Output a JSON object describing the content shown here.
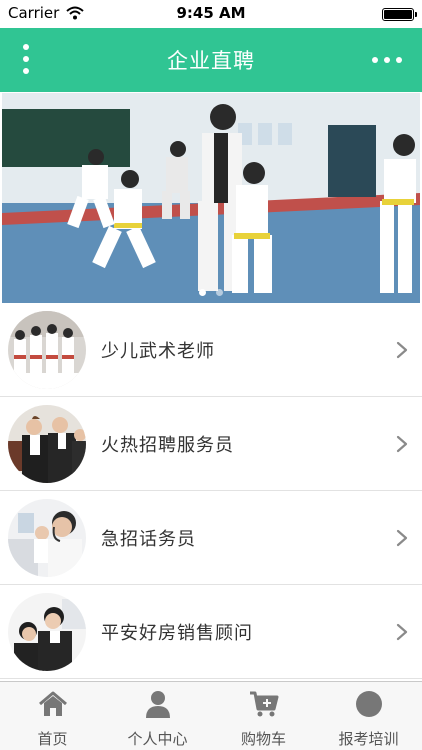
{
  "status_bar": {
    "carrier": "Carrier",
    "time": "9:45 AM"
  },
  "header": {
    "title": "企业直聘",
    "left_icon": "vertical-dots-icon",
    "right_icon": "horizontal-dots-icon"
  },
  "banner": {
    "page_count": 2,
    "active_page": 1
  },
  "jobs": [
    {
      "title": "少儿武术老师",
      "thumb": "kids-martial-arts-photo"
    },
    {
      "title": "火热招聘服务员",
      "thumb": "waiters-photo"
    },
    {
      "title": "急招话务员",
      "thumb": "call-center-photo"
    },
    {
      "title": "平安好房销售顾问",
      "thumb": "sales-consultant-photo"
    }
  ],
  "tabs": [
    {
      "label": "首页",
      "icon": "home-icon"
    },
    {
      "label": "个人中心",
      "icon": "person-icon"
    },
    {
      "label": "购物车",
      "icon": "cart-icon"
    },
    {
      "label": "报考培训",
      "icon": "circle-icon"
    }
  ],
  "colors": {
    "accent": "#30c593",
    "tab_icon": "#777777",
    "chevron": "#8a8a8a"
  }
}
